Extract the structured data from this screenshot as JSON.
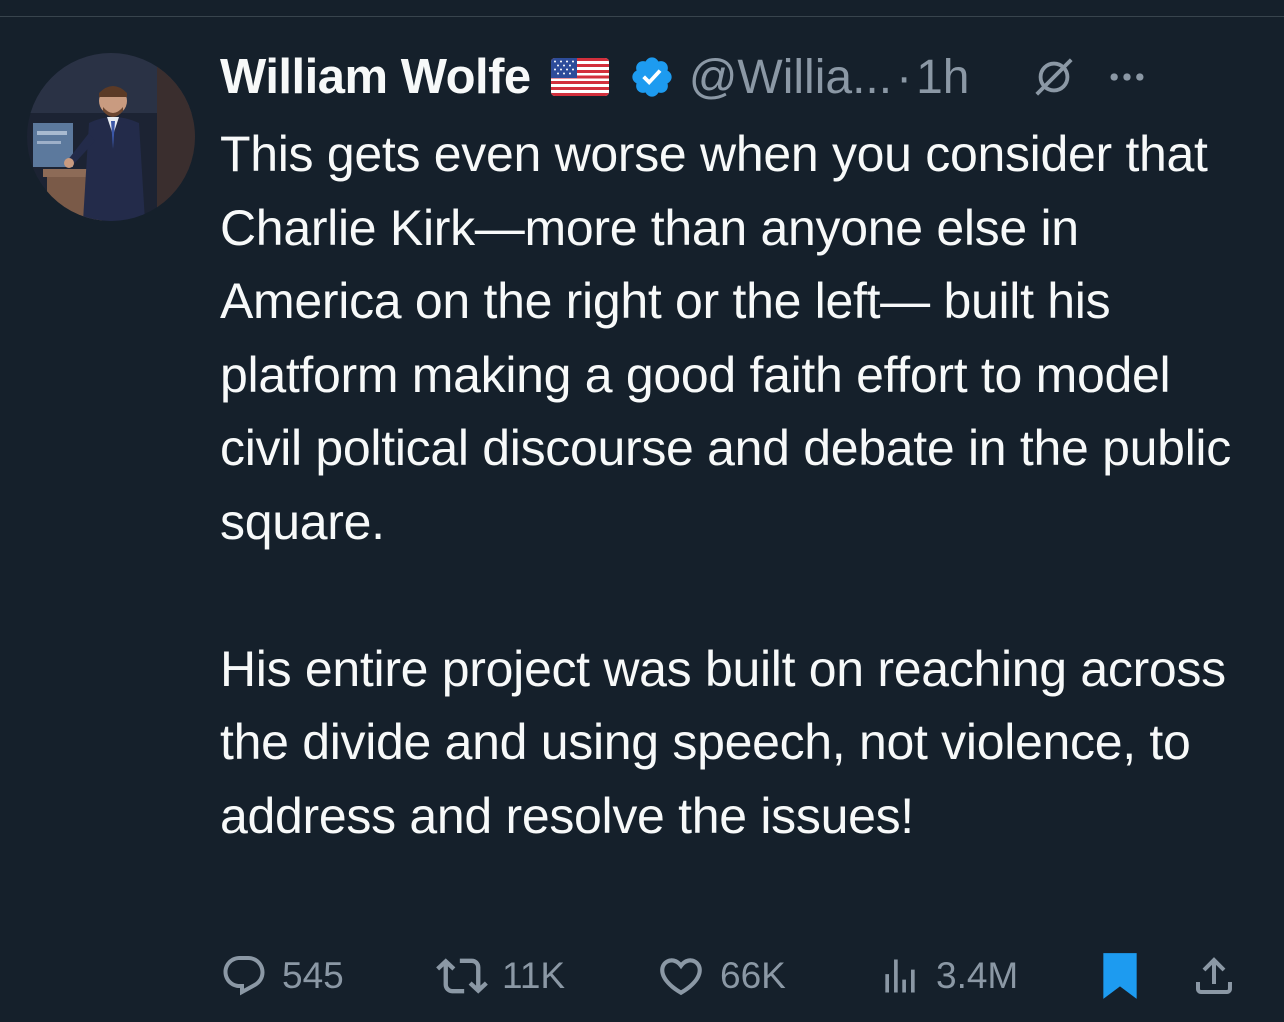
{
  "tweet": {
    "author_name": "William Wolfe",
    "flag": "🇺🇸",
    "handle": "@Willia...",
    "separator": "·",
    "time": "1h",
    "text": "This gets even worse when you consider that Charlie Kirk—more than anyone else in America on the right or the left— built his platform making a good faith effort to model civil poltical discourse and debate in the public square.\n\nHis entire project was built on reaching across the divide and using speech, not violence, to address and resolve the issues!"
  },
  "actions": {
    "replies": "545",
    "reposts": "11K",
    "likes": "66K",
    "views": "3.4M"
  },
  "icons": {
    "verified": "verified-badge-icon",
    "grok": "grok-icon",
    "more": "more-icon",
    "reply": "reply-icon",
    "repost": "repost-icon",
    "like": "heart-icon",
    "views": "views-icon",
    "bookmark": "bookmark-icon",
    "share": "share-icon"
  },
  "colors": {
    "background": "#15202b",
    "text_primary": "#f7f9f9",
    "text_secondary": "#8b98a5",
    "verified_blue": "#1d9bf0",
    "bookmark_active": "#1d9bf0"
  }
}
